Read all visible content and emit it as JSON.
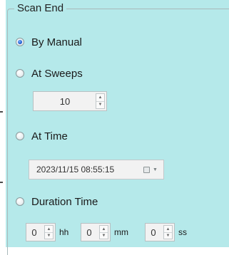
{
  "group_title": "Scan End",
  "options": {
    "by_manual": {
      "label": "By Manual",
      "checked": true
    },
    "at_sweeps": {
      "label": "At Sweeps",
      "checked": false
    },
    "at_time": {
      "label": "At Time",
      "checked": false
    },
    "duration_time": {
      "label": "Duration Time",
      "checked": false
    }
  },
  "sweeps": {
    "value": "10"
  },
  "at_time_value": "2023/11/15 08:55:15",
  "duration": {
    "hours": "0",
    "hours_unit": "hh",
    "minutes": "0",
    "minutes_unit": "mm",
    "seconds": "0",
    "seconds_unit": "ss"
  },
  "icons": {
    "spinner": "spin-up-down-arrows",
    "date_picker": "calendar-icon",
    "dropdown": "chevron-down-icon"
  },
  "colors": {
    "panel_background": "#b5e9ea",
    "radio_selected": "#1e5fcf"
  }
}
